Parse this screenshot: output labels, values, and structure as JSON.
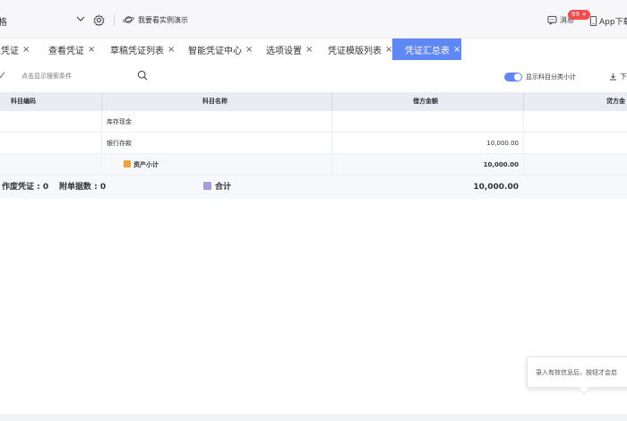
{
  "topbar": {
    "org_name": "格",
    "demo_label": "我要看实例演示",
    "message_label": "消息",
    "message_badge": "99 +",
    "app_download_label": "App下载"
  },
  "tabs": [
    {
      "label": "入凭证"
    },
    {
      "label": "查看凭证"
    },
    {
      "label": "草稿凭证列表"
    },
    {
      "label": "智能凭证中心"
    },
    {
      "label": "选项设置"
    },
    {
      "label": "凭证模版列表"
    },
    {
      "label": "凭证汇总表",
      "active": true
    }
  ],
  "tab_close": "×",
  "toolbar": {
    "search_placeholder": "点击显示搜索条件",
    "toggle_label": "显示科目分类小计",
    "toggle_on": true,
    "download_label": "下"
  },
  "table": {
    "columns": [
      "科目编码",
      "科目名称",
      "借方金额",
      "贷方金"
    ],
    "rows": [
      {
        "code": "",
        "name": "库存现金",
        "debit": "",
        "credit": ""
      },
      {
        "code": "",
        "name": "银行存款",
        "debit": "10,000.00",
        "credit": ""
      }
    ],
    "subtotal": {
      "name": "资产小计",
      "debit": "10,000.00"
    },
    "total": {
      "voucher_label": "作废凭证 : 0",
      "attach_label": "附单据数 : 0",
      "name": "合计",
      "debit": "10,000.00"
    }
  },
  "tooltip": {
    "text": "录入有效信息后，按钮才会启"
  },
  "colors": {
    "accent": "#5f87f5",
    "badge": "#f24b4b",
    "subtotal_icon": "#f0a33a",
    "total_icon": "#a89bdc"
  }
}
